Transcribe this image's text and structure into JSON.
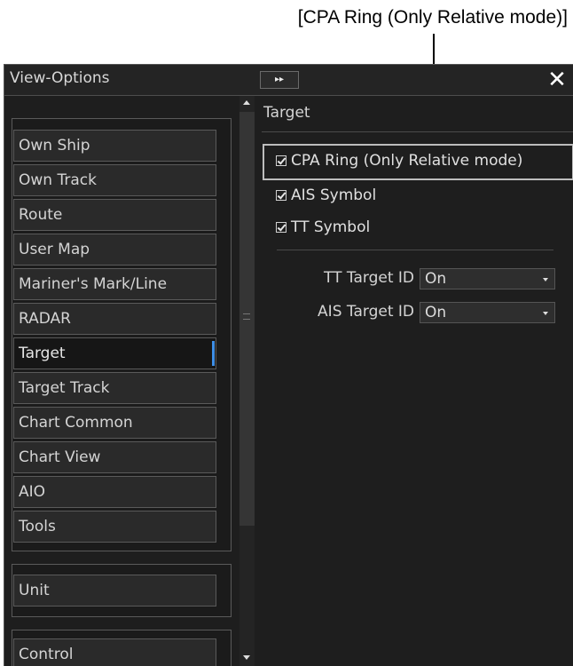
{
  "callout": {
    "label": "[CPA Ring (Only Relative mode)]"
  },
  "window": {
    "title": "View-Options",
    "expand_glyph": "▸▸",
    "close_glyph": "✕"
  },
  "sidebar": {
    "groups": [
      {
        "items": [
          "Own Ship",
          "Own Track",
          "Route",
          "User Map",
          "Mariner's Mark/Line",
          "RADAR",
          "Target",
          "Target Track",
          "Chart Common",
          "Chart View",
          "AIO",
          "Tools"
        ]
      },
      {
        "items": [
          "Unit"
        ]
      },
      {
        "items": [
          "Control"
        ]
      }
    ],
    "active_item": "Target"
  },
  "main": {
    "section_title": "Target",
    "checkboxes": [
      {
        "label": "CPA Ring (Only Relative mode)",
        "checked": true
      },
      {
        "label": "AIS Symbol",
        "checked": true
      },
      {
        "label": "TT Symbol",
        "checked": true
      }
    ],
    "fields": [
      {
        "label": "TT Target ID",
        "value": "On"
      },
      {
        "label": "AIS Target ID",
        "value": "On"
      }
    ]
  },
  "colors": {
    "panel_bg": "#1e1e1e",
    "active_indicator": "#3d8ee6",
    "highlight_border": "#bdbdbd"
  },
  "icons": [
    "close-icon",
    "expand-icon",
    "check-icon",
    "dropdown-arrow-icon",
    "scroll-up-icon",
    "scroll-down-icon"
  ]
}
